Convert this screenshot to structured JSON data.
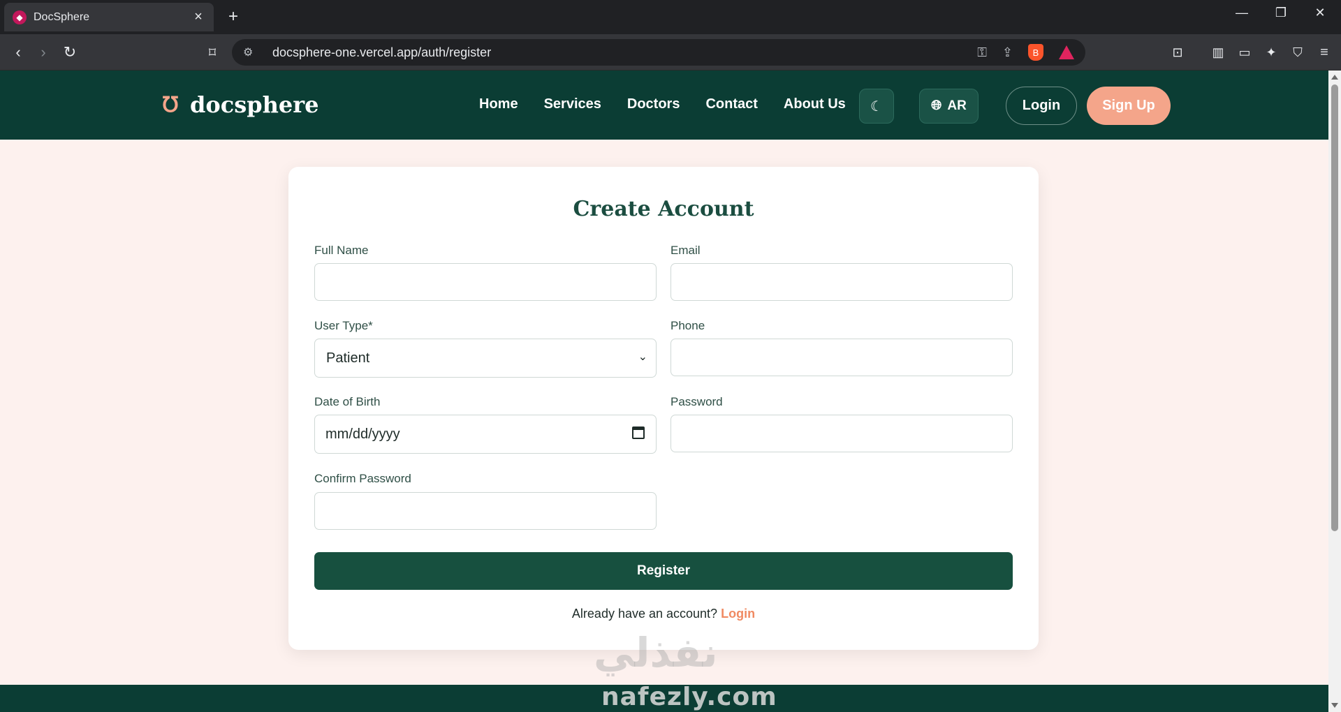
{
  "browser": {
    "tab_title": "DocSphere",
    "url": "docsphere-one.vercel.app/auth/register"
  },
  "navbar": {
    "brand": "docsphere",
    "links": [
      "Home",
      "Services",
      "Doctors",
      "Contact",
      "About Us"
    ],
    "lang_label": "AR",
    "login_label": "Login",
    "signup_label": "Sign Up"
  },
  "form": {
    "title": "Create Account",
    "full_name_label": "Full Name",
    "email_label": "Email",
    "user_type_label": "User Type*",
    "user_type_value": "Patient",
    "phone_label": "Phone",
    "dob_label": "Date of Birth",
    "dob_placeholder": "mm/dd/yyyy",
    "password_label": "Password",
    "confirm_password_label": "Confirm Password",
    "register_label": "Register",
    "already_text": "Already have an account?",
    "login_link": "Login"
  },
  "watermark": {
    "arabic": "نفذلي",
    "latin": "nafezly.com"
  },
  "colors": {
    "nav_bg": "#0b3d34",
    "accent": "#f4a58a",
    "page_bg": "#fdf1ee",
    "primary_button": "#17503f"
  }
}
